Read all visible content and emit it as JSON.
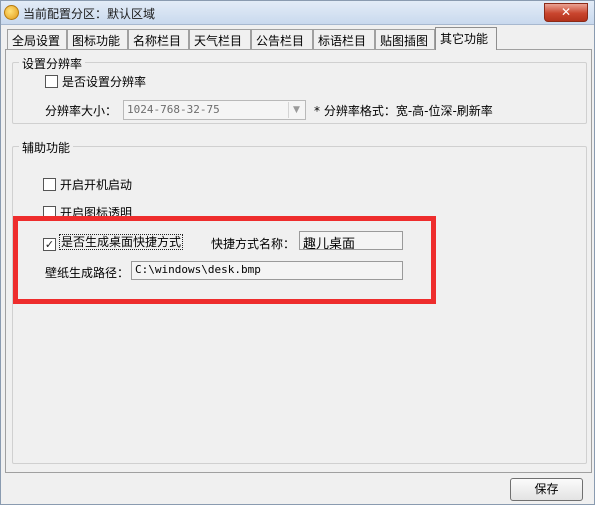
{
  "window": {
    "title": "当前配置分区：默认区域",
    "close_glyph": "✕"
  },
  "tabs": [
    {
      "label": "全局设置",
      "active": false
    },
    {
      "label": "图标功能",
      "active": false
    },
    {
      "label": "名称栏目",
      "active": false
    },
    {
      "label": "天气栏目",
      "active": false
    },
    {
      "label": "公告栏目",
      "active": false
    },
    {
      "label": "标语栏目",
      "active": false
    },
    {
      "label": "贴图插图",
      "active": false
    },
    {
      "label": "其它功能",
      "active": true
    }
  ],
  "resolution_group": {
    "title": "设置分辨率",
    "enable_checkbox": {
      "label": "是否设置分辨率",
      "checked": false
    },
    "size_label": "分辨率大小：",
    "size_value": "1024-768-32-75",
    "format_hint": "* 分辨率格式：宽-高-位深-刷新率"
  },
  "aux_group": {
    "title": "辅助功能",
    "startup_checkbox": {
      "label": "开启开机启动",
      "checked": false
    },
    "transparent_checkbox": {
      "label": "开启图标透明",
      "checked": false
    },
    "shortcut_checkbox": {
      "label": "是否生成桌面快捷方式",
      "checked": true
    },
    "shortcut_name_label": "快捷方式名称：",
    "shortcut_name_value": "趣儿桌面",
    "wallpaper_path_label": "壁纸生成路径：",
    "wallpaper_path_value": "C:\\windows\\desk.bmp"
  },
  "footer": {
    "save_label": "保存"
  },
  "colors": {
    "highlight": "#ee2d2d"
  }
}
